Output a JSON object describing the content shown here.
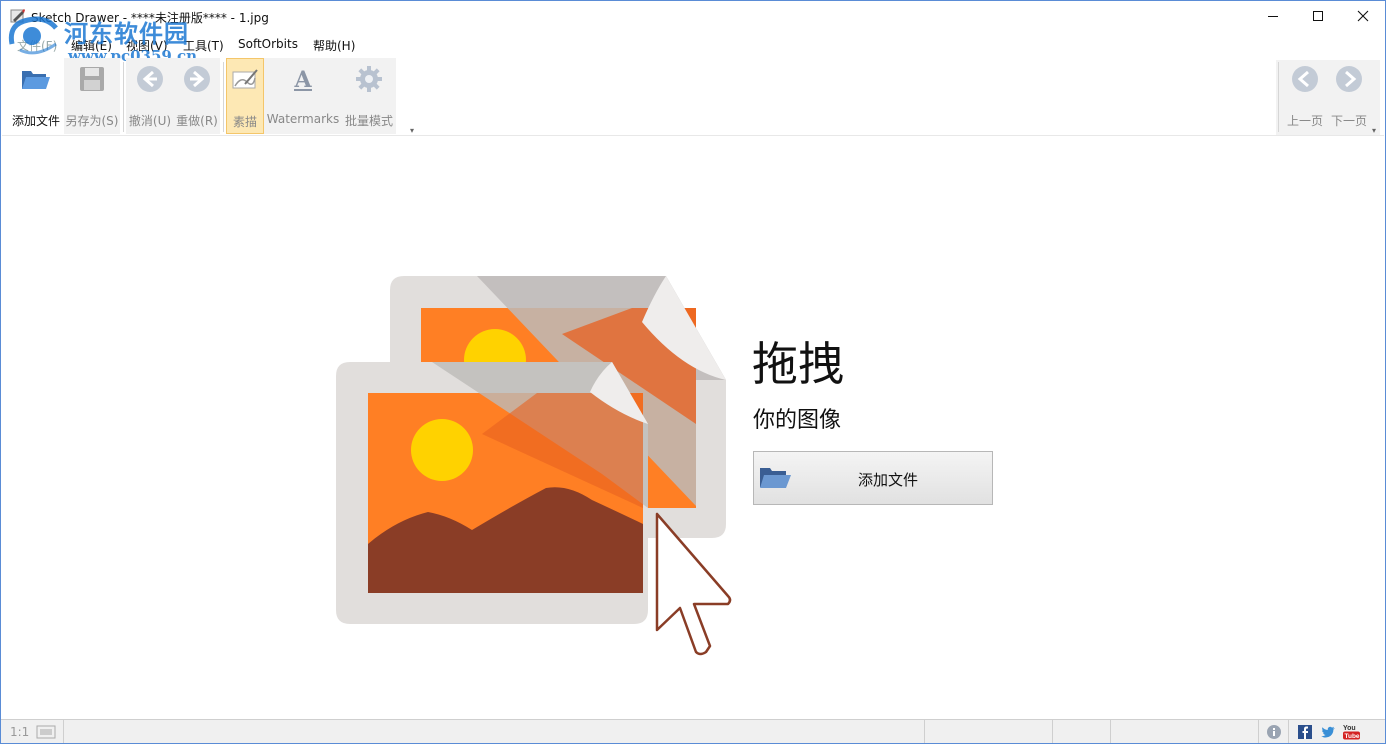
{
  "window": {
    "title": "Sketch Drawer - ****未注册版**** - 1.jpg",
    "minimize_icon": "minimize-icon",
    "maximize_icon": "maximize-icon",
    "close_icon": "close-icon"
  },
  "watermark": {
    "name": "河东软件园",
    "url": "www.pc0359.cn"
  },
  "menu": {
    "items": [
      {
        "label": "文件(F)"
      },
      {
        "label": "编辑(E)"
      },
      {
        "label": "视图(V)"
      },
      {
        "label": "工具(T)"
      },
      {
        "label": "SoftOrbits"
      },
      {
        "label": "帮助(H)"
      }
    ]
  },
  "toolbar": {
    "add_file": "添加文件",
    "save_as": "另存为(S)",
    "undo": "撤消(U)",
    "redo": "重做(R)",
    "sketch": "素描",
    "watermarks": "Watermarks",
    "batch_mode": "批量模式",
    "prev_page": "上一页",
    "next_page": "下一页"
  },
  "main": {
    "drop_title": "拖拽",
    "drop_subtitle": "你的图像",
    "add_button_label": "添加文件"
  },
  "statusbar": {
    "zoom": "1:1",
    "icons": [
      "info-icon",
      "facebook-icon",
      "twitter-icon",
      "youtube-icon"
    ]
  },
  "colors": {
    "accent_orange": "#FF7F24",
    "sun_yellow": "#FFD200",
    "mountain_brown": "#8A3D26",
    "frame_gray": "#E1DEDC",
    "active_tool": "#FDE8B4"
  }
}
